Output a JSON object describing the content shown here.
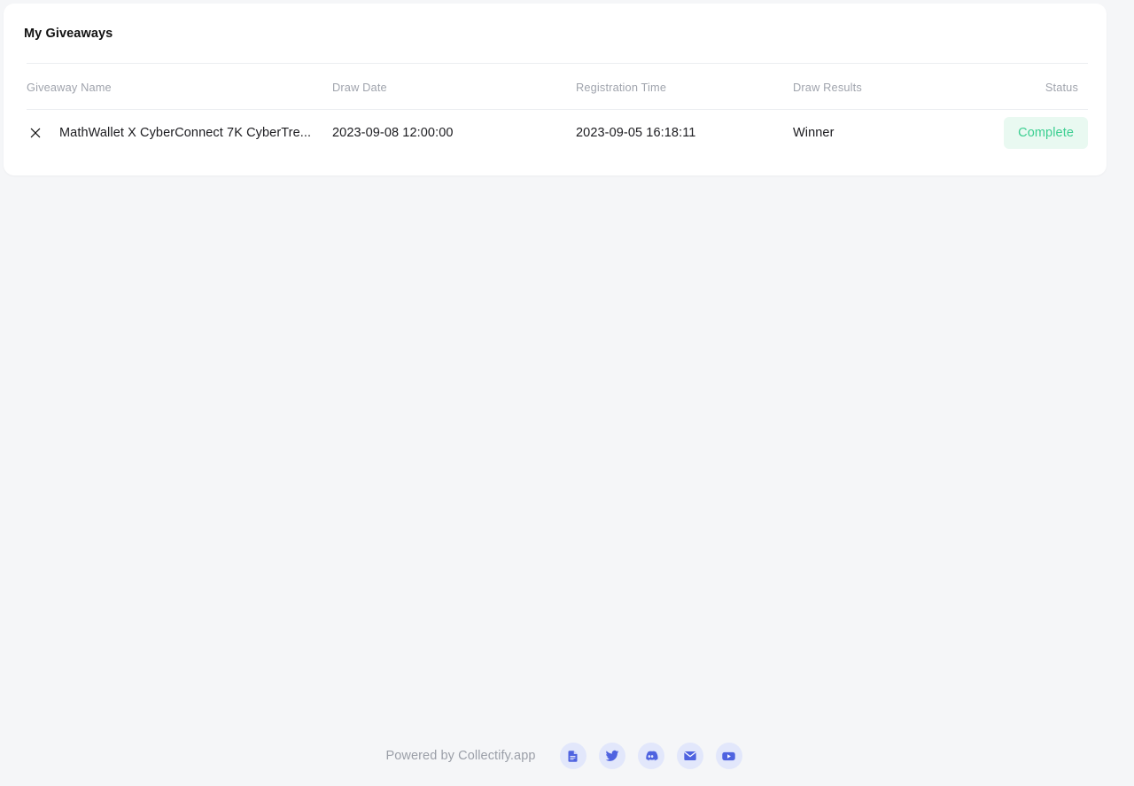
{
  "page": {
    "background_color": "#f5f6f8"
  },
  "card": {
    "title": "My Giveaways",
    "background_color": "#ffffff"
  },
  "table": {
    "columns": [
      {
        "key": "name",
        "label": "Giveaway Name"
      },
      {
        "key": "draw",
        "label": "Draw Date"
      },
      {
        "key": "reg",
        "label": "Registration Time"
      },
      {
        "key": "result",
        "label": "Draw Results"
      },
      {
        "key": "status",
        "label": "Status"
      }
    ],
    "rows": [
      {
        "icon": "x-twitter-icon",
        "name": "MathWallet X CyberConnect 7K CyberTre...",
        "draw_date": "2023-09-08 12:00:00",
        "registration_time": "2023-09-05 16:18:11",
        "draw_results": "Winner",
        "status": "Complete",
        "status_text_color": "#3ccf91",
        "status_bg_color": "#e9f9f1"
      }
    ]
  },
  "footer": {
    "text": "Powered by Collectify.app",
    "icon_color": "#4f63e0",
    "icon_bg_color": "#e2e7fb",
    "social": [
      {
        "name": "docs-icon",
        "title": "Docs"
      },
      {
        "name": "twitter-icon",
        "title": "Twitter"
      },
      {
        "name": "discord-icon",
        "title": "Discord"
      },
      {
        "name": "email-icon",
        "title": "Email"
      },
      {
        "name": "youtube-icon",
        "title": "YouTube"
      }
    ]
  }
}
